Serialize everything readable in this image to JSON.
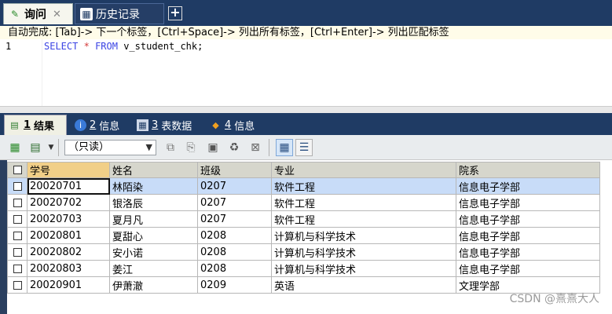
{
  "top_tabs": {
    "query_label": "询问",
    "history_label": "历史记录",
    "close_glyph": "✕",
    "new_tab_glyph": "+"
  },
  "editor": {
    "hint": "自动完成: [Tab]-> 下一个标签，[Ctrl+Space]-> 列出所有标签，[Ctrl+Enter]-> 列出匹配标签",
    "line_number": "1",
    "code_select": "SELECT",
    "code_star": "*",
    "code_from": "FROM",
    "code_rest": "v_student_chk;"
  },
  "result_tabs": [
    {
      "num": "1",
      "label": "结果",
      "active": true
    },
    {
      "num": "2",
      "label": "信息",
      "active": false
    },
    {
      "num": "3",
      "label": "表数据",
      "active": false
    },
    {
      "num": "4",
      "label": "信息",
      "active": false
    }
  ],
  "toolbar": {
    "mode_value": "（只读）",
    "icons": [
      "add-row-icon",
      "export-icon",
      "copy-icon",
      "duplicate-icon",
      "save-icon",
      "delete-icon",
      "cancel-icon",
      "grid-view-icon",
      "text-view-icon"
    ]
  },
  "grid": {
    "columns": [
      "学号",
      "姓名",
      "班级",
      "专业",
      "院系"
    ],
    "rows": [
      [
        "20020701",
        "林陌染",
        "0207",
        "软件工程",
        "信息电子学部"
      ],
      [
        "20020702",
        "银洛辰",
        "0207",
        "软件工程",
        "信息电子学部"
      ],
      [
        "20020703",
        "夏月凡",
        "0207",
        "软件工程",
        "信息电子学部"
      ],
      [
        "20020801",
        "夏甜心",
        "0208",
        "计算机与科学技术",
        "信息电子学部"
      ],
      [
        "20020802",
        "安小诺",
        "0208",
        "计算机与科学技术",
        "信息电子学部"
      ],
      [
        "20020803",
        "姜江",
        "0208",
        "计算机与科学技术",
        "信息电子学部"
      ],
      [
        "20020901",
        "伊萧澈",
        "0209",
        "英语",
        "文理学部"
      ]
    ],
    "selected_row": 0
  },
  "watermark": "CSDN @熹熹大人",
  "colors": {
    "chrome_navy": "#1f3b64",
    "selection_blue": "#c8dcf8",
    "sorted_header": "#f1cf88",
    "keyword_blue": "#3b44e4",
    "star_red": "#d43a3a"
  }
}
